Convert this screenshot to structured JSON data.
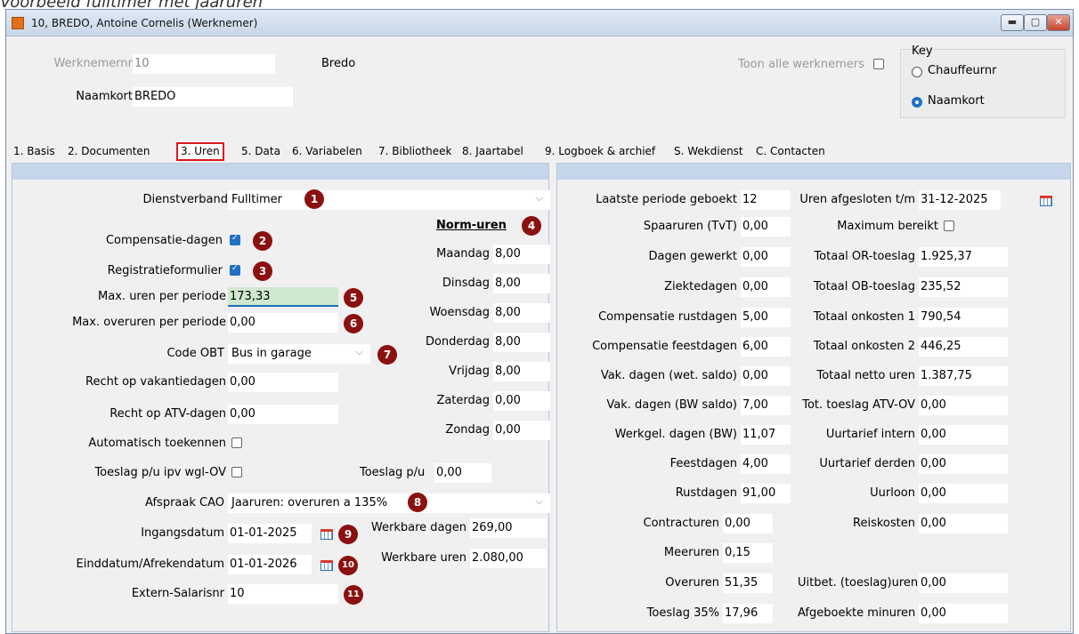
{
  "caption": "Voorbeeld fulltimer met jaaruren",
  "window": {
    "title": "10, BREDO, Antoine Cornelis (Werknemer)"
  },
  "header": {
    "werknemernr_label": "Werknemernr",
    "werknemernr_value": "10",
    "name_display": "Bredo",
    "naamkort_label": "Naamkort",
    "naamkort_value": "BREDO",
    "toon_alle_label": "Toon alle werknemers",
    "key": {
      "title": "Key",
      "opt1": "Chauffeurnr",
      "opt2": "Naamkort",
      "selected": "Naamkort"
    }
  },
  "tabs": [
    "1. Basis",
    "2. Documenten",
    "3. Uren",
    "5. Data",
    "6. Variabelen",
    "7. Bibliotheek",
    "8. Jaartabel",
    "9. Logboek & archief",
    "S. Wekdienst",
    "C. Contacten"
  ],
  "active_tab": "3. Uren",
  "left": {
    "dienstverband": {
      "label": "Dienstverband",
      "value": "Fulltimer",
      "badge": "1"
    },
    "compensatie": {
      "label": "Compensatie-dagen",
      "checked": true,
      "badge": "2"
    },
    "registratie": {
      "label": "Registratieformulier",
      "checked": true,
      "badge": "3"
    },
    "max_uren": {
      "label": "Max. uren per periode",
      "value": "173,33",
      "badge": "5"
    },
    "max_overuren": {
      "label": "Max. overuren per periode",
      "value": "0,00",
      "badge": "6"
    },
    "code_obt": {
      "label": "Code OBT",
      "value": "Bus in garage",
      "badge": "7"
    },
    "recht_vakantie": {
      "label": "Recht op vakantiedagen",
      "value": "0,00"
    },
    "recht_atv": {
      "label": "Recht op ATV-dagen",
      "value": "0,00"
    },
    "auto_toekennen": {
      "label": "Automatisch toekennen",
      "checked": false
    },
    "toeslag_pu_wgl": {
      "label": "Toeslag p/u ipv wgl-OV",
      "checked": false
    },
    "toeslag_pu": {
      "label": "Toeslag p/u",
      "value": "0,00"
    },
    "afspraak_cao": {
      "label": "Afspraak CAO",
      "value": "Jaaruren: overuren a 135%",
      "badge": "8"
    },
    "ingangsdatum": {
      "label": "Ingangsdatum",
      "value": "01-01-2025",
      "badge": "9"
    },
    "einddatum": {
      "label": "Einddatum/Afrekendatum",
      "value": "01-01-2026",
      "badge": "10"
    },
    "extern_salarisnr": {
      "label": "Extern-Salarisnr",
      "value": "10",
      "badge": "11"
    },
    "norm_uren": {
      "title": "Norm-uren",
      "badge": "4",
      "days": [
        {
          "label": "Maandag",
          "value": "8,00"
        },
        {
          "label": "Dinsdag",
          "value": "8,00"
        },
        {
          "label": "Woensdag",
          "value": "8,00"
        },
        {
          "label": "Donderdag",
          "value": "8,00"
        },
        {
          "label": "Vrijdag",
          "value": "8,00"
        },
        {
          "label": "Zaterdag",
          "value": "0,00"
        },
        {
          "label": "Zondag",
          "value": "0,00"
        }
      ]
    },
    "werkbare_dagen": {
      "label": "Werkbare dagen",
      "value": "269,00"
    },
    "werkbare_uren": {
      "label": "Werkbare uren",
      "value": "2.080,00"
    }
  },
  "right": {
    "col1": [
      {
        "label": "Laatste periode geboekt",
        "value": "12"
      },
      {
        "label": "Spaaruren (TvT)",
        "value": "0,00"
      },
      {
        "label": "Dagen gewerkt",
        "value": "0,00"
      },
      {
        "label": "Ziektedagen",
        "value": "0,00"
      },
      {
        "label": "Compensatie rustdagen",
        "value": "5,00"
      },
      {
        "label": "Compensatie feestdagen",
        "value": "6,00"
      },
      {
        "label": "Vak. dagen (wet. saldo)",
        "value": "0,00"
      },
      {
        "label": "Vak. dagen (BW saldo)",
        "value": "7,00"
      },
      {
        "label": "Werkgel. dagen (BW)",
        "value": "11,07"
      },
      {
        "label": "Feestdagen",
        "value": "4,00"
      },
      {
        "label": "Rustdagen",
        "value": "91,00"
      },
      {
        "label": "Contracturen",
        "value": "0,00"
      },
      {
        "label": "Meeruren",
        "value": "0,15"
      },
      {
        "label": "Overuren",
        "value": "51,35"
      },
      {
        "label": "Toeslag 35%",
        "value": "17,96"
      }
    ],
    "uren_afgesloten": {
      "label": "Uren afgesloten t/m",
      "value": "31-12-2025"
    },
    "maximum_bereikt": {
      "label": "Maximum bereikt",
      "checked": false
    },
    "col2": [
      {
        "label": "Totaal OR-toeslag",
        "value": "1.925,37"
      },
      {
        "label": "Totaal OB-toeslag",
        "value": "235,52"
      },
      {
        "label": "Totaal onkosten 1",
        "value": "790,54"
      },
      {
        "label": "Totaal onkosten 2",
        "value": "446,25"
      },
      {
        "label": "Totaal netto uren",
        "value": "1.387,75"
      },
      {
        "label": "Tot. toeslag ATV-OV",
        "value": "0,00"
      },
      {
        "label": "Uurtarief intern",
        "value": "0,00"
      },
      {
        "label": "Uurtarief derden",
        "value": "0,00"
      },
      {
        "label": "Uurloon",
        "value": "0,00"
      },
      {
        "label": "Reiskosten",
        "value": "0,00"
      }
    ],
    "uitbet": {
      "label": "Uitbet. (toeslag)uren",
      "value": "0,00"
    },
    "afgeboekte": {
      "label": "Afgeboekte minuren",
      "value": "0,00"
    }
  },
  "colors": {
    "badge": "#8b1010",
    "accent": "#1f6fc5",
    "active_tab_border": "#d9171d"
  }
}
